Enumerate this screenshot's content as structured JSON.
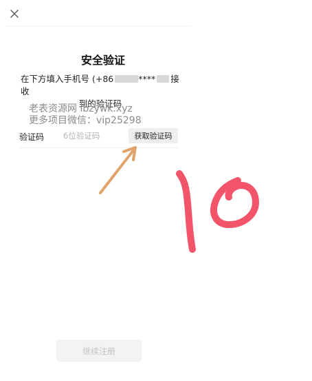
{
  "header": {
    "close_icon": "close-icon"
  },
  "verify": {
    "title": "安全验证",
    "instruction_prefix": "在下方填入手机号 (+86",
    "instruction_masked_middle": "****",
    "instruction_suffix": "接收",
    "instruction_line2": "到的验证码"
  },
  "watermark": {
    "line1": "老表资源网 lbzywk.xyz",
    "line2": "更多项目微信：vip25298"
  },
  "code_field": {
    "label": "验证码",
    "placeholder": "6位验证码",
    "value": "",
    "send_label": "获取验证码"
  },
  "footer": {
    "continue_label": "继续注册"
  },
  "annotation": {
    "arrow_color": "#e0a46a",
    "handwriting_color": "#f2546a"
  }
}
